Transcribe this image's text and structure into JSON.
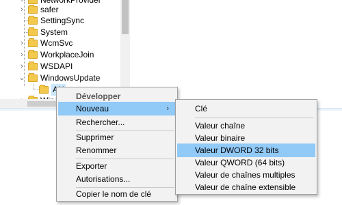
{
  "tree": {
    "items": [
      {
        "label": "NetworkProvider",
        "expanded": false
      },
      {
        "label": "safer",
        "expanded": false
      },
      {
        "label": "SettingSync",
        "expanded": false
      },
      {
        "label": "System",
        "expanded": false
      },
      {
        "label": "WcmSvc",
        "expanded": false
      },
      {
        "label": "WorkplaceJoin",
        "expanded": false
      },
      {
        "label": "WSDAPI",
        "expanded": false
      },
      {
        "label": "WindowsUpdate",
        "expanded": true
      },
      {
        "label": "AU",
        "selected": true
      },
      {
        "label": "Windows",
        "expanded": false
      }
    ]
  },
  "context_menu": {
    "header": "Développer",
    "new": "Nouveau",
    "search": "Rechercher...",
    "delete": "Supprimer",
    "rename": "Renommer",
    "export": "Exporter",
    "permissions": "Autorisations...",
    "copy_key": "Copier le nom de clé"
  },
  "submenu": {
    "key": "Clé",
    "string": "Valeur chaîne",
    "binary": "Valeur binaire",
    "dword": "Valeur DWORD 32 bits",
    "qword": "Valeur QWORD (64 bits)",
    "multi_string": "Valeur de chaînes multiples",
    "expand_string": "Valeur de chaîne extensible"
  },
  "colors": {
    "highlight": "#91c9f7",
    "folder": "#f2c94c",
    "menu_bg": "#f2f2f2"
  }
}
